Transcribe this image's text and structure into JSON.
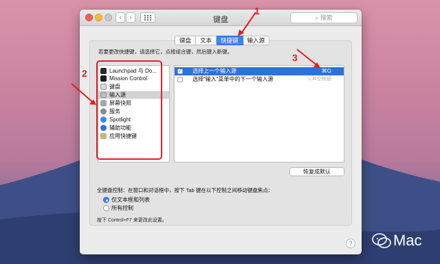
{
  "window": {
    "title": "键盘",
    "search_placeholder": "搜索"
  },
  "tabs": [
    {
      "label": "键盘",
      "active": false
    },
    {
      "label": "文本",
      "active": false
    },
    {
      "label": "快捷键",
      "active": true
    },
    {
      "label": "输入源",
      "active": false
    }
  ],
  "instruction": "若要更改快捷键，请选择它，点按组合键，然后键入新键。",
  "categories": [
    {
      "label": "Launchpad 与 Do...",
      "icon": "launchpad-icon",
      "selected": false
    },
    {
      "label": "Mission Control",
      "icon": "mission-control-icon",
      "selected": false
    },
    {
      "label": "键盘",
      "icon": "keyboard-icon",
      "selected": false
    },
    {
      "label": "输入源",
      "icon": "input-source-icon",
      "selected": true
    },
    {
      "label": "屏幕快照",
      "icon": "screenshot-icon",
      "selected": false
    },
    {
      "label": "服务",
      "icon": "services-gear-icon",
      "selected": false
    },
    {
      "label": "Spotlight",
      "icon": "spotlight-icon",
      "selected": false
    },
    {
      "label": "辅助功能",
      "icon": "accessibility-icon",
      "selected": false
    },
    {
      "label": "应用快捷键",
      "icon": "app-shortcuts-icon",
      "selected": false
    }
  ],
  "shortcuts": [
    {
      "label": "选择上一个输入源",
      "key": "⌘G",
      "checked": true,
      "selected": true,
      "dim": false
    },
    {
      "label": "选择“输入”菜单中的下一个输入源",
      "key": "⌥⌘空格键",
      "checked": false,
      "selected": false,
      "dim": true
    }
  ],
  "restore_button": "恢复成默认",
  "full_keyboard_access": "全键盘控制：在窗口和对话框中，按下 Tab 键在以下控制之间移动键盘焦点：",
  "radio_options": [
    {
      "label": "仅文本框和列表",
      "selected": true
    },
    {
      "label": "所有控制",
      "selected": false
    }
  ],
  "note": "按下 Control+F7 来更改此设置。",
  "help_label": "?",
  "annotations": {
    "marker1": "1",
    "marker2": "2",
    "marker3": "3",
    "color": "#e11f1f"
  },
  "watermark": "Mac",
  "colors": {
    "accent": "#3b84f5",
    "selection": "#2e72d8"
  }
}
